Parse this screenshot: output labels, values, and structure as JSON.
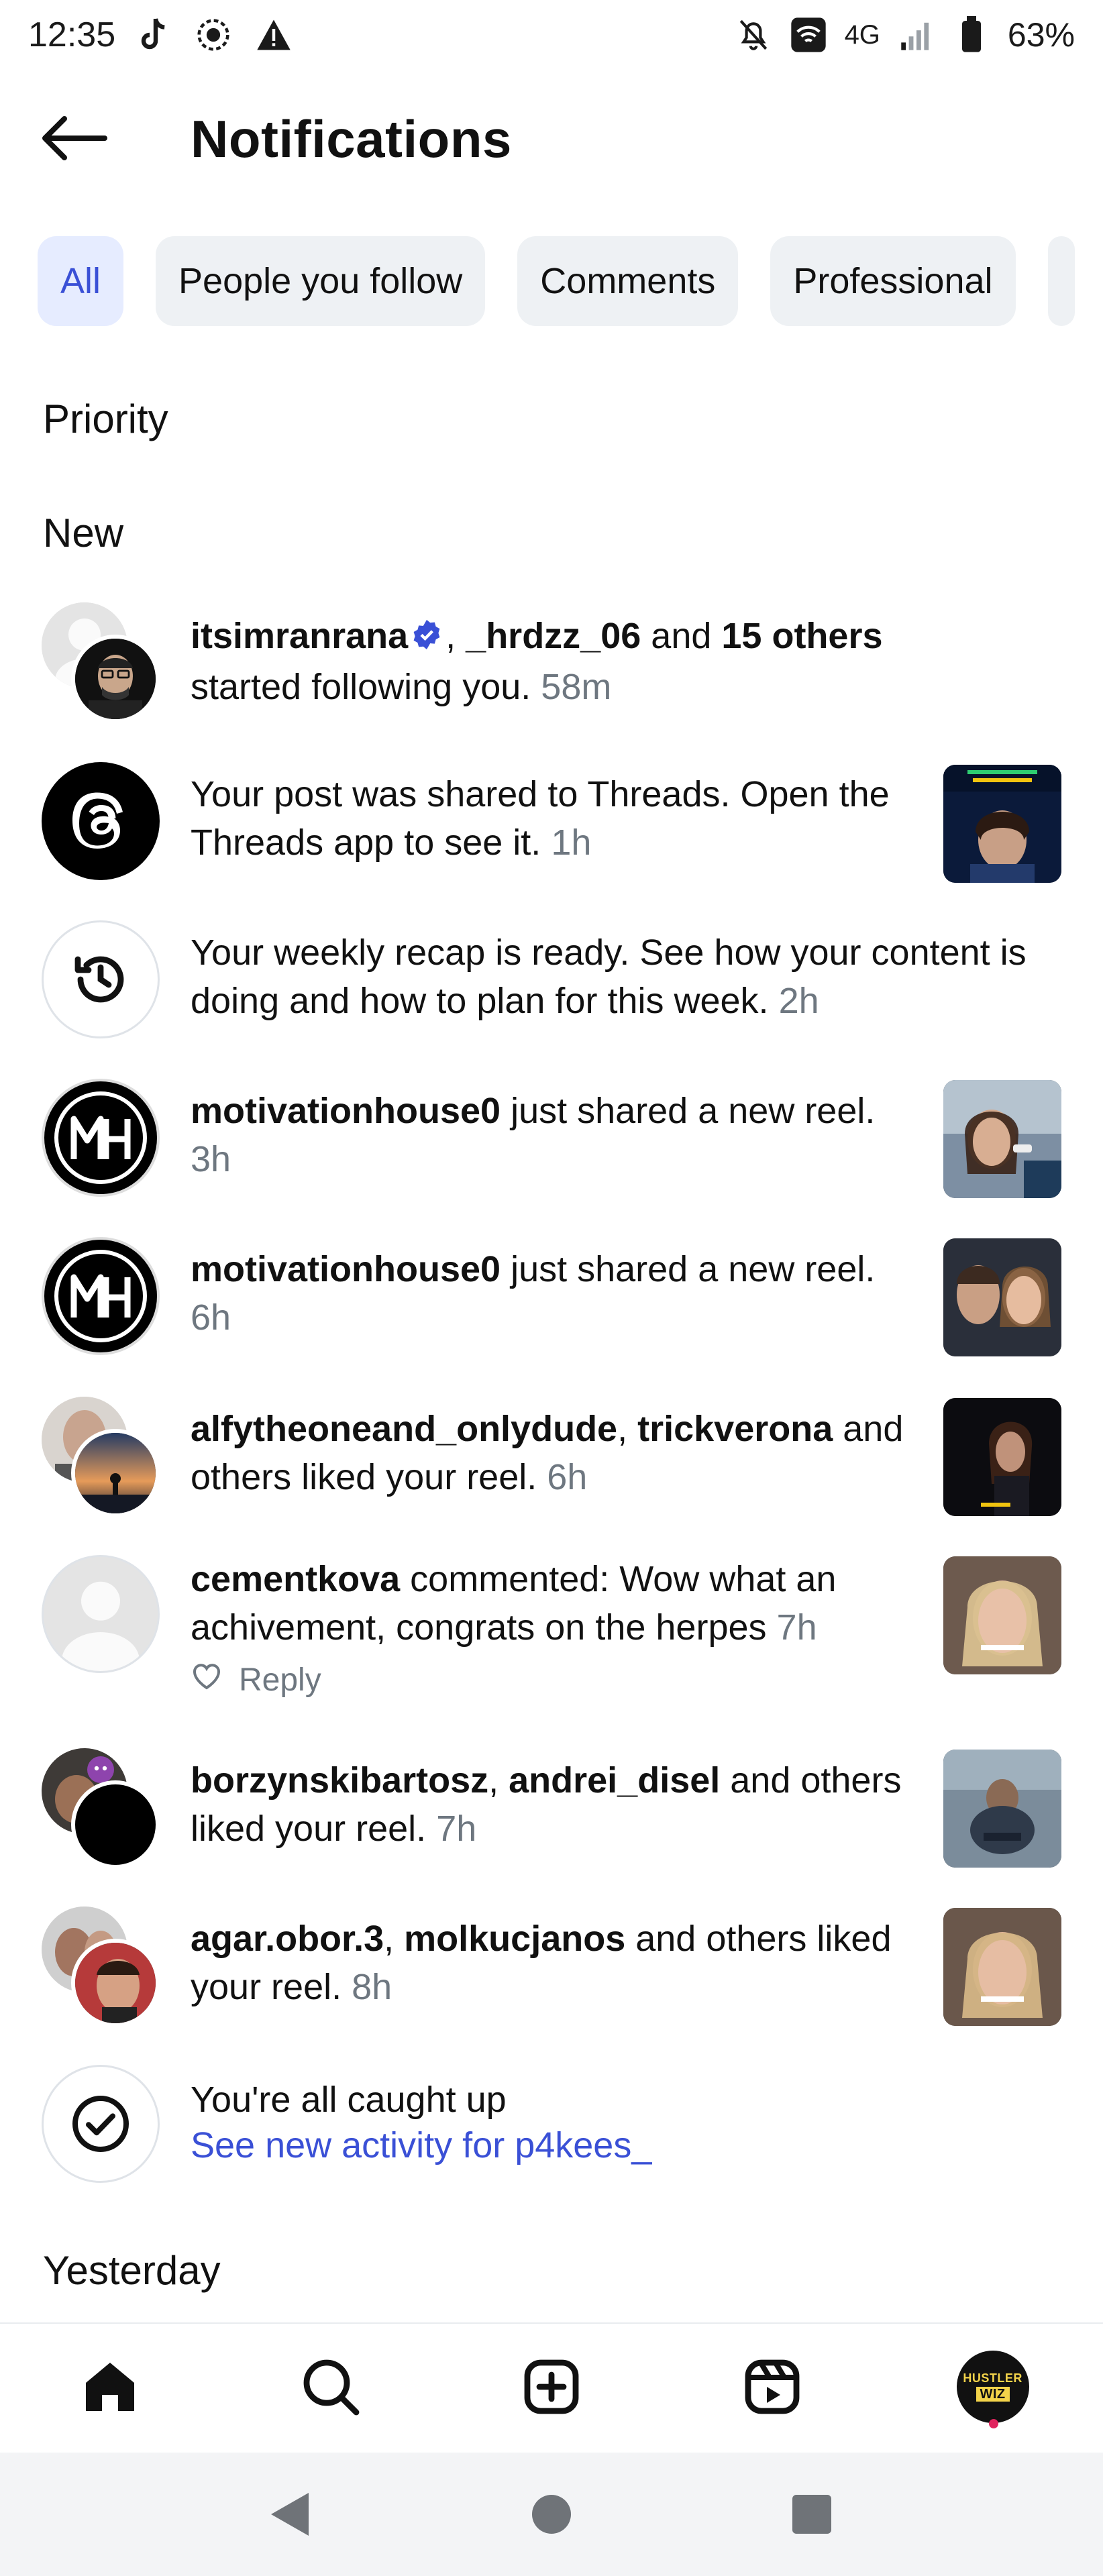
{
  "status_bar": {
    "time": "12:35",
    "network": "4G",
    "battery": "63%"
  },
  "header": {
    "title": "Notifications"
  },
  "chips": [
    "All",
    "People you follow",
    "Comments",
    "Professional"
  ],
  "sections": {
    "priority": "Priority",
    "new": "New",
    "yesterday": "Yesterday"
  },
  "notifications": [
    {
      "u1": "itsimranrana",
      "sep1": ", ",
      "u2": "_hrdzz_06",
      "mid": " and ",
      "u3": "15 others",
      "tail": " started following you.",
      "time": "58m"
    },
    {
      "text": "Your post was shared to Threads. Open the Threads app to see it.",
      "time": "1h"
    },
    {
      "text": "Your weekly recap is ready. See how your content is doing and how to plan for this week.",
      "time": "2h"
    },
    {
      "user": "motivationhouse0",
      "text": " just shared a new reel.",
      "time": "3h"
    },
    {
      "user": "motivationhouse0",
      "text": " just shared a new reel.",
      "time": "6h"
    },
    {
      "u1": "alfytheoneand_onlydude",
      "sep": ", ",
      "u2": "trickverona",
      "tail": " and others liked your reel.",
      "time": "6h"
    },
    {
      "user": "cementkova",
      "text": " commented: Wow what an achivement, congrats on the herpes",
      "time": "7h",
      "reply": "Reply"
    },
    {
      "u1": "borzynskibartosz",
      "sep": ", ",
      "u2": "andrei_disel",
      "tail": " and others liked your reel.",
      "time": "7h"
    },
    {
      "u1": "agar.obor.3",
      "sep": ", ",
      "u2": "molkucjanos",
      "tail": " and others liked your reel.",
      "time": "8h"
    }
  ],
  "caught_up": {
    "title": "You're all caught up",
    "link": "See new activity for p4kees_"
  },
  "profile_avatar": {
    "line1": "HUSTLER",
    "line2": "WIZ"
  },
  "colors": {
    "accent": "#3a50d6",
    "chip_bg": "#eef1f4",
    "chip_active_bg": "#e6ecff",
    "muted": "#6e7780"
  }
}
